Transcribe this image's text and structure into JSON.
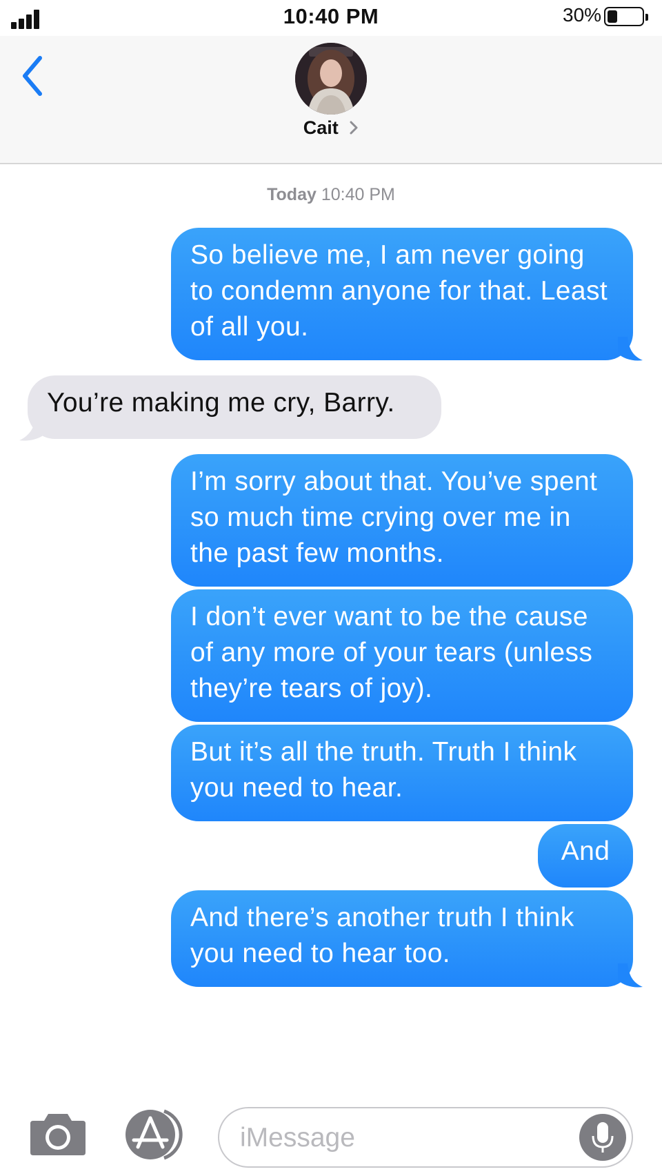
{
  "status_bar": {
    "time": "10:40 PM",
    "battery_percent": "30%",
    "battery_level": 0.3,
    "signal_bars": 4
  },
  "header": {
    "contact_name": "Cait",
    "back_icon": "chevron-left-icon",
    "detail_icon": "chevron-right-icon"
  },
  "conversation": {
    "timestamp_day": "Today",
    "timestamp_time": "10:40 PM",
    "messages": [
      {
        "direction": "sent",
        "text": "So believe me, I am never going to condemn anyone for that. Least of all you."
      },
      {
        "direction": "received",
        "text": "You’re making me cry, Barry."
      },
      {
        "direction": "sent",
        "text": "I’m sorry about that. You’ve spent so much time crying over me in the past few months."
      },
      {
        "direction": "sent",
        "text": "I don’t ever want to be the cause of any more of your tears (unless they’re tears of joy)."
      },
      {
        "direction": "sent",
        "text": "But it’s all the truth. Truth I think you need to hear."
      },
      {
        "direction": "sent",
        "text": "And"
      },
      {
        "direction": "sent",
        "text": "And there’s another truth I think you need to hear too."
      }
    ]
  },
  "input_bar": {
    "placeholder": "iMessage",
    "camera_icon": "camera-icon",
    "apps_icon": "app-store-icon",
    "mic_icon": "microphone-icon"
  },
  "colors": {
    "sent_bubble": "#1f86fb",
    "received_bubble": "#e6e5eb",
    "accent": "#1a7cf5"
  }
}
